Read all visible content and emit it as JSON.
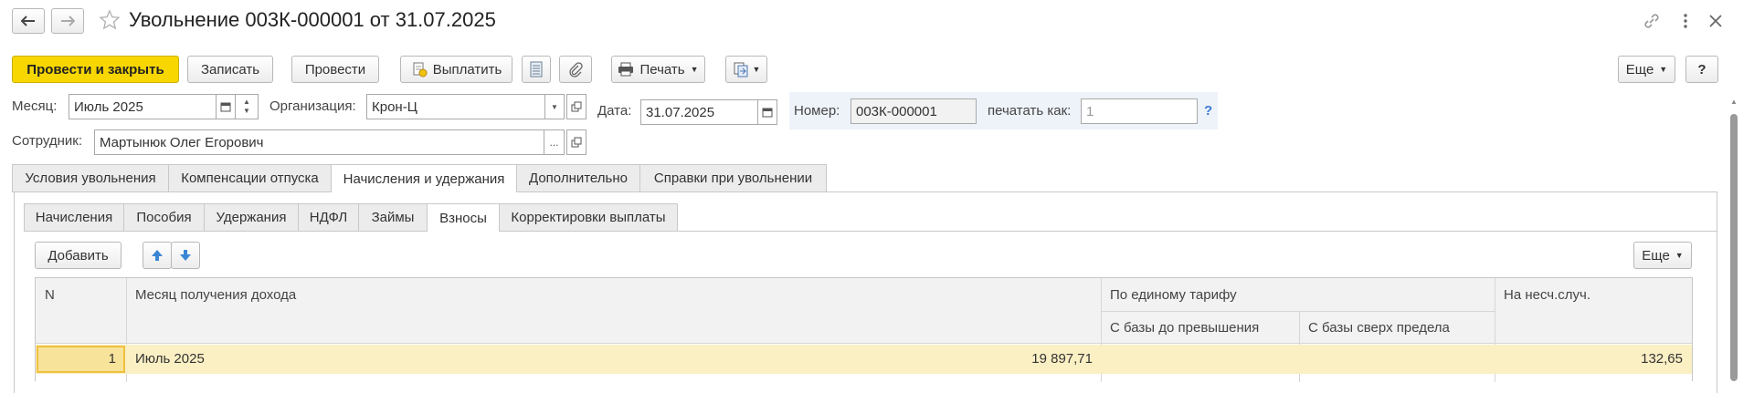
{
  "header": {
    "title": "Увольнение 003К-000001 от 31.07.2025"
  },
  "toolbar": {
    "post_close": "Провести и закрыть",
    "write": "Записать",
    "post": "Провести",
    "pay": "Выплатить",
    "print": "Печать",
    "more": "Еще",
    "help": "?"
  },
  "form": {
    "month_label": "Месяц:",
    "month_value": "Июль 2025",
    "org_label": "Организация:",
    "org_value": "Крон-Ц",
    "date_label": "Дата:",
    "date_value": "31.07.2025",
    "number_label": "Номер:",
    "number_value": "003К-000001",
    "print_as_label": "печатать как:",
    "print_as_placeholder": "1",
    "print_as_help": "?",
    "employee_label": "Сотрудник:",
    "employee_value": "Мартынюк Олег Егорович",
    "employee_select": "..."
  },
  "tabs": [
    {
      "label": "Условия увольнения"
    },
    {
      "label": "Компенсации отпуска"
    },
    {
      "label": "Начисления и удержания"
    },
    {
      "label": "Дополнительно"
    },
    {
      "label": "Справки при увольнении"
    }
  ],
  "subtabs": [
    {
      "label": "Начисления"
    },
    {
      "label": "Пособия"
    },
    {
      "label": "Удержания"
    },
    {
      "label": "НДФЛ"
    },
    {
      "label": "Займы"
    },
    {
      "label": "Взносы"
    },
    {
      "label": "Корректировки выплаты"
    }
  ],
  "table_toolbar": {
    "add": "Добавить",
    "more": "Еще"
  },
  "table": {
    "col_n": "N",
    "col_month": "Месяц получения дохода",
    "col_group_unified": "По единому тарифу",
    "col_base_below": "С базы до превышения",
    "col_base_above": "С базы сверх предела",
    "col_accident": "На несч.случ.",
    "rows": [
      {
        "n": "1",
        "month": "Июль 2025",
        "base_below": "19 897,71",
        "base_above": "",
        "accident": "132,65"
      }
    ]
  }
}
